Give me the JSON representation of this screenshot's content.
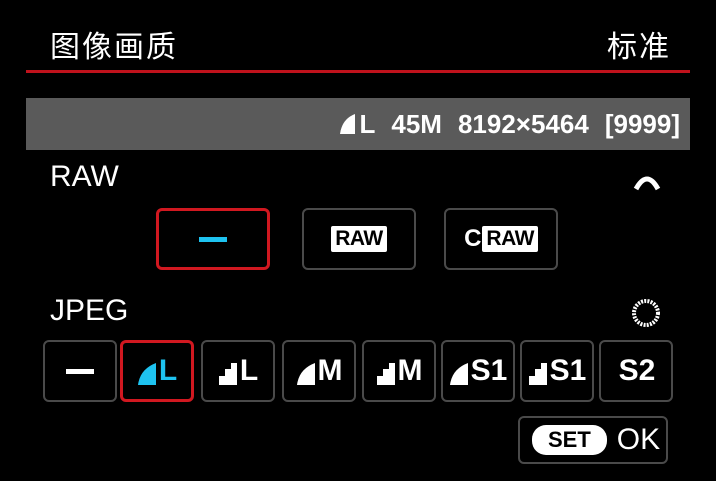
{
  "header": {
    "title": "图像画质",
    "status": "标准"
  },
  "info": {
    "quality_label": "L",
    "megapixels": "45M",
    "resolution": "8192×5464",
    "shots": "[9999]"
  },
  "raw": {
    "label": "RAW",
    "options": [
      {
        "type": "dash",
        "selected": true
      },
      {
        "type": "raw",
        "text": "RAW",
        "selected": false
      },
      {
        "type": "craw",
        "prefix": "C",
        "text": "RAW",
        "selected": false
      }
    ]
  },
  "jpeg": {
    "label": "JPEG",
    "options": [
      {
        "type": "dash",
        "selected": false
      },
      {
        "icon": "fine-quality-icon",
        "size": "L",
        "selected": true
      },
      {
        "icon": "normal-quality-icon",
        "size": "L",
        "selected": false
      },
      {
        "icon": "fine-quality-icon",
        "size": "M",
        "selected": false
      },
      {
        "icon": "normal-quality-icon",
        "size": "M",
        "selected": false
      },
      {
        "icon": "fine-quality-icon",
        "size": "S1",
        "selected": false
      },
      {
        "icon": "normal-quality-icon",
        "size": "S1",
        "selected": false
      },
      {
        "icon": "none",
        "size": "S2",
        "selected": false
      }
    ]
  },
  "footer": {
    "set_label": "SET",
    "ok_label": "OK"
  },
  "colors": {
    "accent": "#d11820",
    "highlight": "#1ec3f0",
    "info_bar": "#5a5a5a",
    "divider": "#c0121c"
  },
  "icons": {
    "raw_dial": "main-dial-icon",
    "jpeg_dial": "quick-control-dial-icon"
  }
}
